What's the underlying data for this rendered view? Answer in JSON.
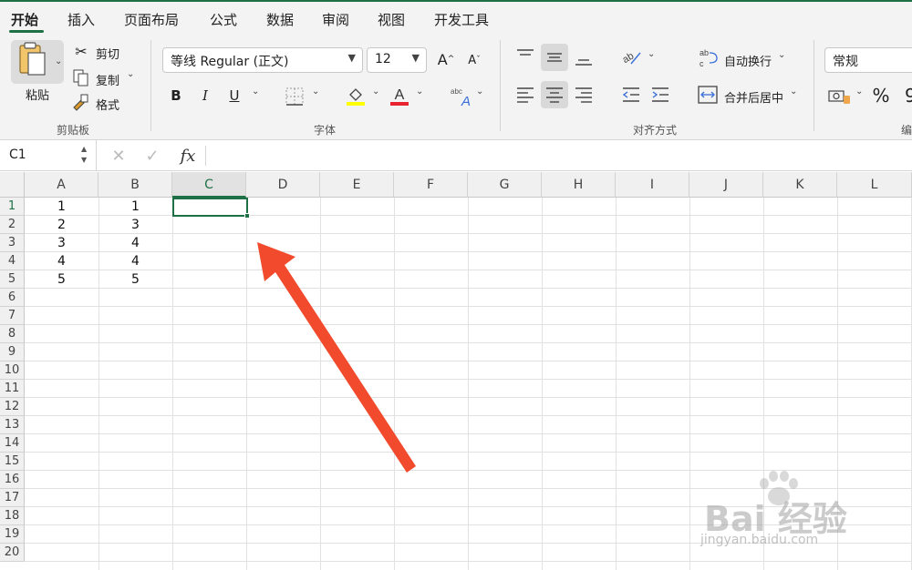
{
  "tabs": [
    {
      "label": "开始",
      "active": true
    },
    {
      "label": "插入"
    },
    {
      "label": "页面布局"
    },
    {
      "label": "公式"
    },
    {
      "label": "数据"
    },
    {
      "label": "审阅"
    },
    {
      "label": "视图"
    },
    {
      "label": "开发工具"
    }
  ],
  "ribbon": {
    "clipboard": {
      "paste_label": "粘贴",
      "cut_label": "剪切",
      "copy_label": "复制",
      "format_painter_label": "格式",
      "group_label": "剪贴板"
    },
    "font": {
      "font_name": "等线 Regular (正文)",
      "font_size": "12",
      "group_label": "字体"
    },
    "alignment": {
      "wrap_text_label": "自动换行",
      "merge_center_label": "合并后居中",
      "group_label": "对齐方式"
    },
    "number": {
      "format_value": "常规",
      "group_label": "编"
    }
  },
  "formula_bar": {
    "name_box": "C1",
    "fx_label": "fx",
    "formula": ""
  },
  "grid": {
    "columns": [
      "A",
      "B",
      "C",
      "D",
      "E",
      "F",
      "G",
      "H",
      "I",
      "J",
      "K",
      "L"
    ],
    "rows": [
      "1",
      "2",
      "3",
      "4",
      "5",
      "6",
      "7",
      "8",
      "9",
      "10",
      "11",
      "12",
      "13",
      "14",
      "15",
      "16",
      "17",
      "18",
      "19",
      "20"
    ],
    "selected_cell": "C1",
    "cells": {
      "A": [
        "1",
        "2",
        "3",
        "4",
        "5"
      ],
      "B": [
        "1",
        "3",
        "4",
        "4",
        "5"
      ]
    }
  },
  "colors": {
    "accent": "#1e7145",
    "annotation_arrow": "#f24a2c"
  },
  "watermark": {
    "line1": "Bai 经验",
    "line2": "jingyan.baidu.com"
  }
}
